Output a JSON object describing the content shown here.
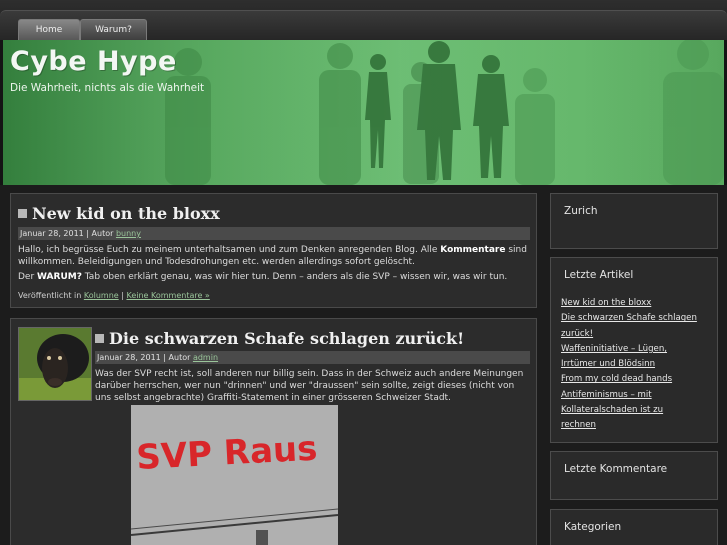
{
  "nav": {
    "tabs": [
      {
        "label": "Home"
      },
      {
        "label": "Warum?"
      }
    ]
  },
  "header": {
    "title": "Cybe Hype",
    "subtitle": "Die Wahrheit, nichts als die Wahrheit"
  },
  "posts": [
    {
      "title": "New kid on the bloxx",
      "meta_date": "Januar 28, 2011 | Autor ",
      "meta_author": "bunny",
      "p1_a": "Hallo, ich begrüsse Euch zu meinem unterhaltsamen und zum Denken anregenden Blog. Alle ",
      "p1_b": "Kommentare",
      "p1_c": " sind willkommen. Beleidigungen und Todesdrohungen etc. werden allerdings sofort gelöscht.",
      "p2_a": "Der ",
      "p2_b": "WARUM?",
      "p2_c": " Tab oben erklärt genau, was wir hier tun. Denn – anders als die SVP – wissen wir, was wir tun.",
      "foot_prefix": "Veröffentlicht in ",
      "foot_category": "Kolumne",
      "foot_sep": " | ",
      "foot_comments": "Keine Kommentare »"
    },
    {
      "title": "Die schwarzen Schafe schlagen zurück!",
      "meta_date": "Januar 28, 2011 | Autor ",
      "meta_author": "admin",
      "text": "Was der SVP recht ist, soll anderen nur billig sein. Dass in der Schweiz auch andere Meinungen darüber herrschen, wer nun \"drinnen\" und wer \"draussen\" sein sollte, zeigt dieses (nicht von uns selbst angebrachte) Graffiti-Statement in einer grösseren Schweizer Stadt.",
      "graffiti": "SVP Raus"
    }
  ],
  "sidebar": {
    "search_title": "Zurich",
    "recent_title": "Letzte Artikel",
    "recent_items": [
      "New kid on the bloxx",
      "Die schwarzen Schafe schlagen",
      "zurück!",
      "Waffeninitiative – Lügen,",
      "Irrtümer und Blödsinn",
      "From my cold dead hands",
      "Antifeminismus – mit",
      "Kollateralschaden ist zu",
      "rechnen"
    ],
    "comments_title": "Letzte Kommentare",
    "categories_title": "Kategorien"
  },
  "colors": {
    "header_green": "#5cad63",
    "background": "#1c1c1c",
    "link_green": "#9ac59a"
  }
}
